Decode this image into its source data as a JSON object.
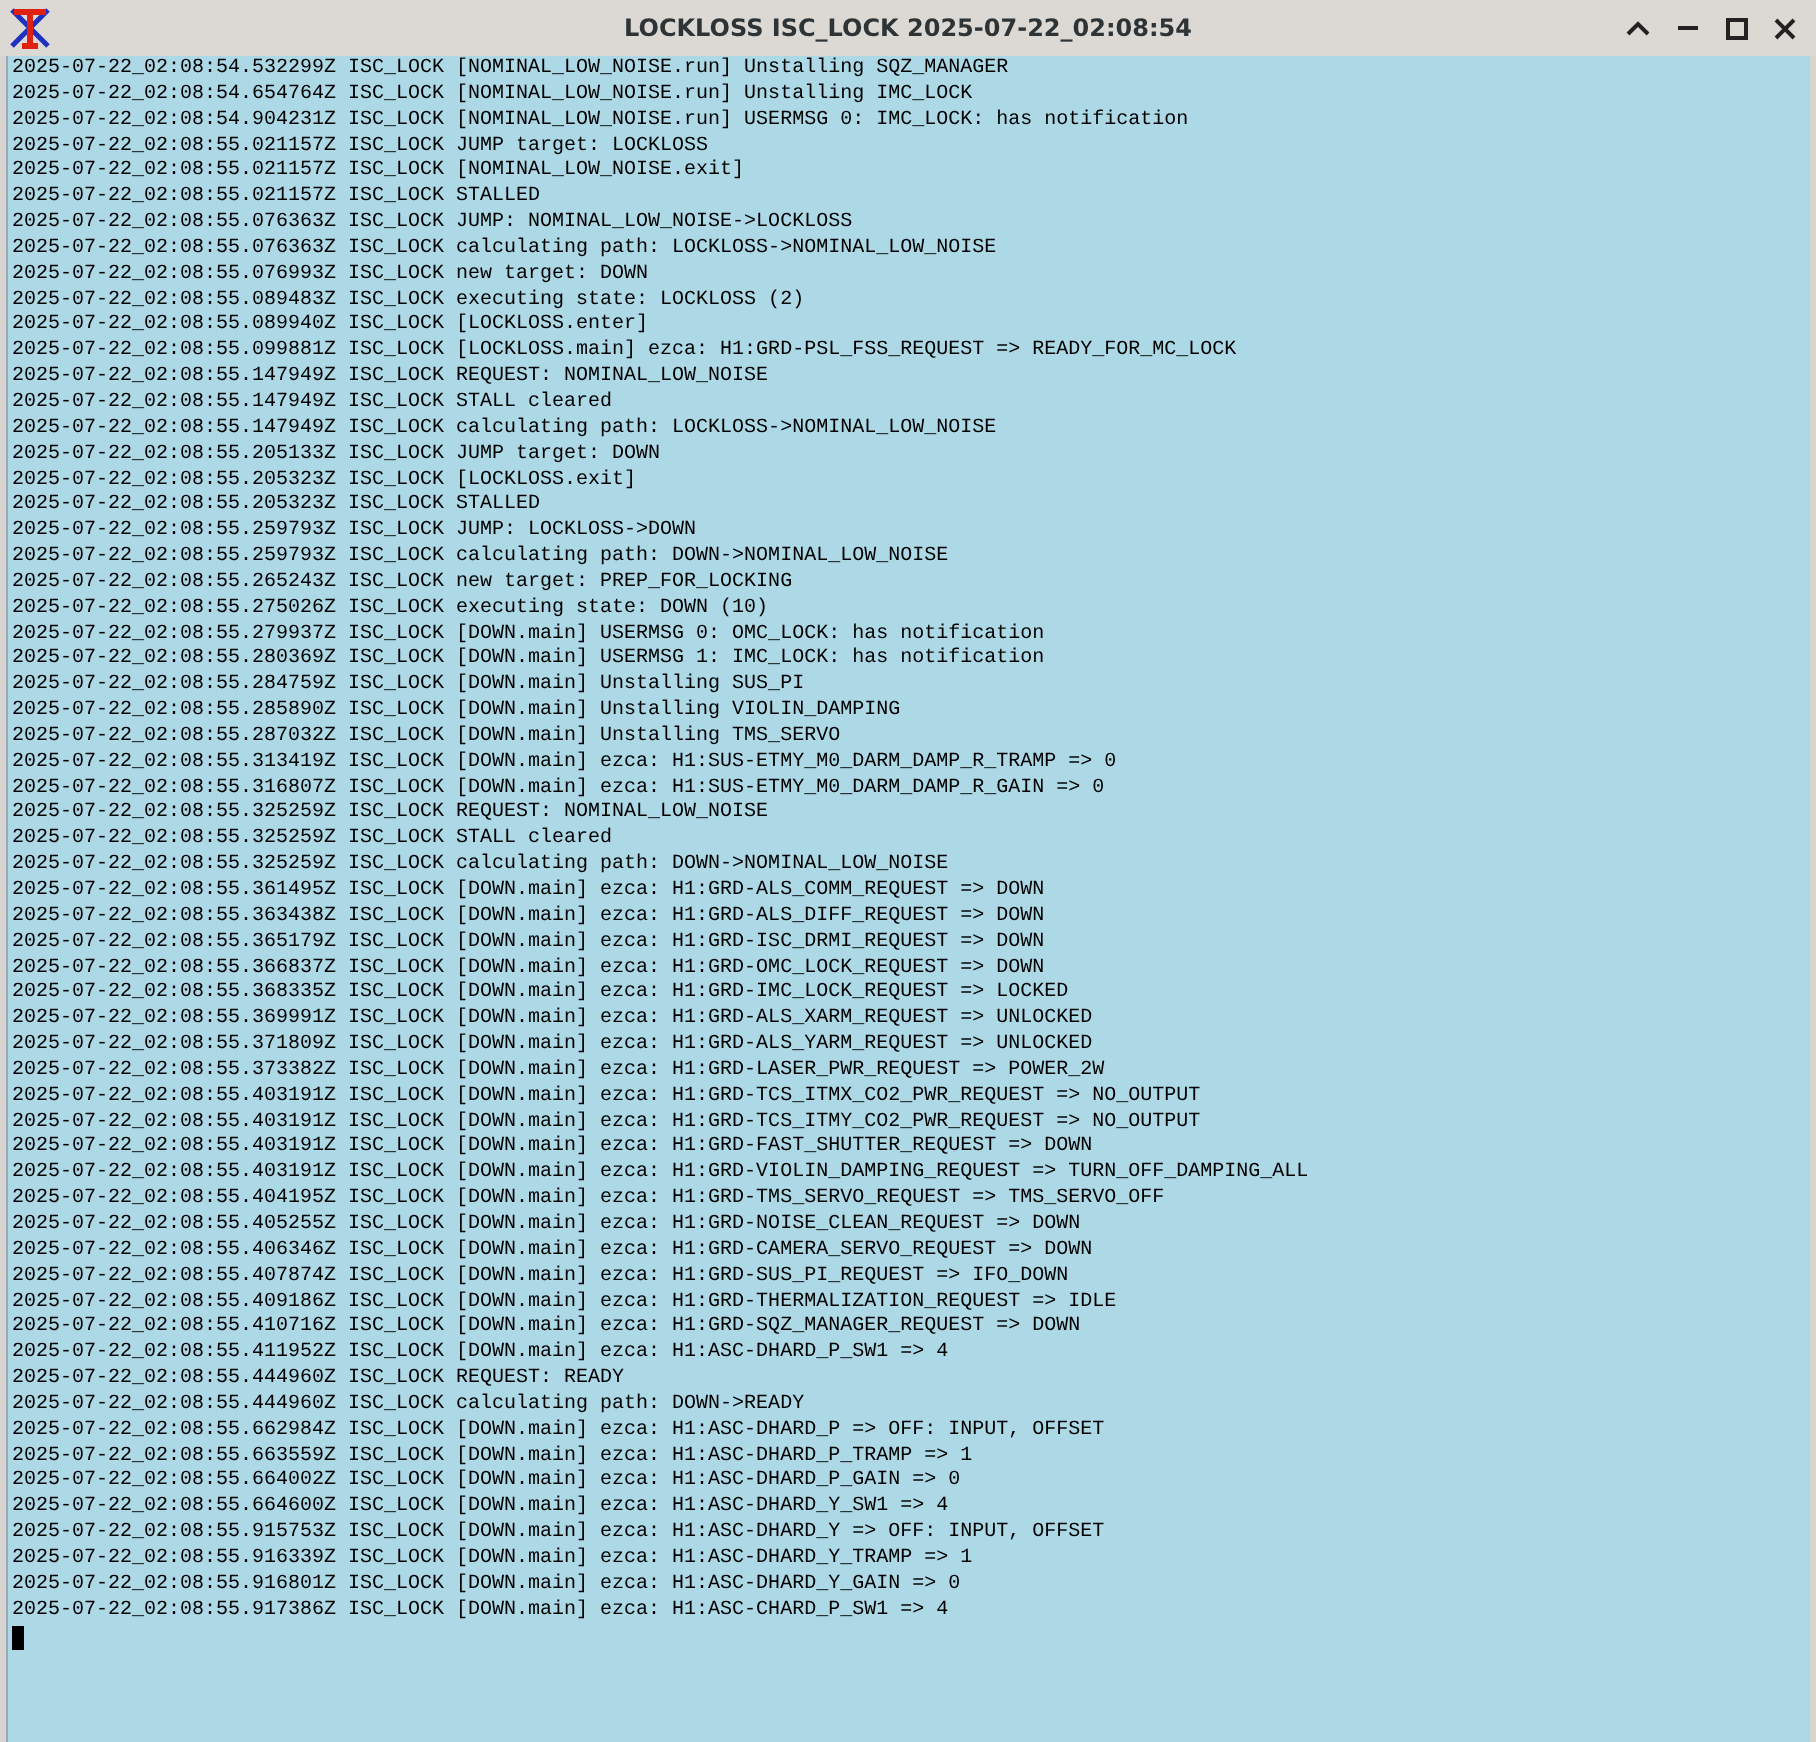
{
  "window": {
    "title": "LOCKLOSS ISC_LOCK 2025-07-22_02:08:54"
  },
  "log_lines": [
    "2025-07-22_02:08:54.532299Z ISC_LOCK [NOMINAL_LOW_NOISE.run] Unstalling SQZ_MANAGER",
    "2025-07-22_02:08:54.654764Z ISC_LOCK [NOMINAL_LOW_NOISE.run] Unstalling IMC_LOCK",
    "2025-07-22_02:08:54.904231Z ISC_LOCK [NOMINAL_LOW_NOISE.run] USERMSG 0: IMC_LOCK: has notification",
    "2025-07-22_02:08:55.021157Z ISC_LOCK JUMP target: LOCKLOSS",
    "2025-07-22_02:08:55.021157Z ISC_LOCK [NOMINAL_LOW_NOISE.exit]",
    "2025-07-22_02:08:55.021157Z ISC_LOCK STALLED",
    "2025-07-22_02:08:55.076363Z ISC_LOCK JUMP: NOMINAL_LOW_NOISE->LOCKLOSS",
    "2025-07-22_02:08:55.076363Z ISC_LOCK calculating path: LOCKLOSS->NOMINAL_LOW_NOISE",
    "2025-07-22_02:08:55.076993Z ISC_LOCK new target: DOWN",
    "2025-07-22_02:08:55.089483Z ISC_LOCK executing state: LOCKLOSS (2)",
    "2025-07-22_02:08:55.089940Z ISC_LOCK [LOCKLOSS.enter]",
    "2025-07-22_02:08:55.099881Z ISC_LOCK [LOCKLOSS.main] ezca: H1:GRD-PSL_FSS_REQUEST => READY_FOR_MC_LOCK",
    "2025-07-22_02:08:55.147949Z ISC_LOCK REQUEST: NOMINAL_LOW_NOISE",
    "2025-07-22_02:08:55.147949Z ISC_LOCK STALL cleared",
    "2025-07-22_02:08:55.147949Z ISC_LOCK calculating path: LOCKLOSS->NOMINAL_LOW_NOISE",
    "2025-07-22_02:08:55.205133Z ISC_LOCK JUMP target: DOWN",
    "2025-07-22_02:08:55.205323Z ISC_LOCK [LOCKLOSS.exit]",
    "2025-07-22_02:08:55.205323Z ISC_LOCK STALLED",
    "2025-07-22_02:08:55.259793Z ISC_LOCK JUMP: LOCKLOSS->DOWN",
    "2025-07-22_02:08:55.259793Z ISC_LOCK calculating path: DOWN->NOMINAL_LOW_NOISE",
    "2025-07-22_02:08:55.265243Z ISC_LOCK new target: PREP_FOR_LOCKING",
    "2025-07-22_02:08:55.275026Z ISC_LOCK executing state: DOWN (10)",
    "2025-07-22_02:08:55.279937Z ISC_LOCK [DOWN.main] USERMSG 0: OMC_LOCK: has notification",
    "2025-07-22_02:08:55.280369Z ISC_LOCK [DOWN.main] USERMSG 1: IMC_LOCK: has notification",
    "2025-07-22_02:08:55.284759Z ISC_LOCK [DOWN.main] Unstalling SUS_PI",
    "2025-07-22_02:08:55.285890Z ISC_LOCK [DOWN.main] Unstalling VIOLIN_DAMPING",
    "2025-07-22_02:08:55.287032Z ISC_LOCK [DOWN.main] Unstalling TMS_SERVO",
    "2025-07-22_02:08:55.313419Z ISC_LOCK [DOWN.main] ezca: H1:SUS-ETMY_M0_DARM_DAMP_R_TRAMP => 0",
    "2025-07-22_02:08:55.316807Z ISC_LOCK [DOWN.main] ezca: H1:SUS-ETMY_M0_DARM_DAMP_R_GAIN => 0",
    "2025-07-22_02:08:55.325259Z ISC_LOCK REQUEST: NOMINAL_LOW_NOISE",
    "2025-07-22_02:08:55.325259Z ISC_LOCK STALL cleared",
    "2025-07-22_02:08:55.325259Z ISC_LOCK calculating path: DOWN->NOMINAL_LOW_NOISE",
    "2025-07-22_02:08:55.361495Z ISC_LOCK [DOWN.main] ezca: H1:GRD-ALS_COMM_REQUEST => DOWN",
    "2025-07-22_02:08:55.363438Z ISC_LOCK [DOWN.main] ezca: H1:GRD-ALS_DIFF_REQUEST => DOWN",
    "2025-07-22_02:08:55.365179Z ISC_LOCK [DOWN.main] ezca: H1:GRD-ISC_DRMI_REQUEST => DOWN",
    "2025-07-22_02:08:55.366837Z ISC_LOCK [DOWN.main] ezca: H1:GRD-OMC_LOCK_REQUEST => DOWN",
    "2025-07-22_02:08:55.368335Z ISC_LOCK [DOWN.main] ezca: H1:GRD-IMC_LOCK_REQUEST => LOCKED",
    "2025-07-22_02:08:55.369991Z ISC_LOCK [DOWN.main] ezca: H1:GRD-ALS_XARM_REQUEST => UNLOCKED",
    "2025-07-22_02:08:55.371809Z ISC_LOCK [DOWN.main] ezca: H1:GRD-ALS_YARM_REQUEST => UNLOCKED",
    "2025-07-22_02:08:55.373382Z ISC_LOCK [DOWN.main] ezca: H1:GRD-LASER_PWR_REQUEST => POWER_2W",
    "2025-07-22_02:08:55.403191Z ISC_LOCK [DOWN.main] ezca: H1:GRD-TCS_ITMX_CO2_PWR_REQUEST => NO_OUTPUT",
    "2025-07-22_02:08:55.403191Z ISC_LOCK [DOWN.main] ezca: H1:GRD-TCS_ITMY_CO2_PWR_REQUEST => NO_OUTPUT",
    "2025-07-22_02:08:55.403191Z ISC_LOCK [DOWN.main] ezca: H1:GRD-FAST_SHUTTER_REQUEST => DOWN",
    "2025-07-22_02:08:55.403191Z ISC_LOCK [DOWN.main] ezca: H1:GRD-VIOLIN_DAMPING_REQUEST => TURN_OFF_DAMPING_ALL",
    "2025-07-22_02:08:55.404195Z ISC_LOCK [DOWN.main] ezca: H1:GRD-TMS_SERVO_REQUEST => TMS_SERVO_OFF",
    "2025-07-22_02:08:55.405255Z ISC_LOCK [DOWN.main] ezca: H1:GRD-NOISE_CLEAN_REQUEST => DOWN",
    "2025-07-22_02:08:55.406346Z ISC_LOCK [DOWN.main] ezca: H1:GRD-CAMERA_SERVO_REQUEST => DOWN",
    "2025-07-22_02:08:55.407874Z ISC_LOCK [DOWN.main] ezca: H1:GRD-SUS_PI_REQUEST => IFO_DOWN",
    "2025-07-22_02:08:55.409186Z ISC_LOCK [DOWN.main] ezca: H1:GRD-THERMALIZATION_REQUEST => IDLE",
    "2025-07-22_02:08:55.410716Z ISC_LOCK [DOWN.main] ezca: H1:GRD-SQZ_MANAGER_REQUEST => DOWN",
    "2025-07-22_02:08:55.411952Z ISC_LOCK [DOWN.main] ezca: H1:ASC-DHARD_P_SW1 => 4",
    "2025-07-22_02:08:55.444960Z ISC_LOCK REQUEST: READY",
    "2025-07-22_02:08:55.444960Z ISC_LOCK calculating path: DOWN->READY",
    "2025-07-22_02:08:55.662984Z ISC_LOCK [DOWN.main] ezca: H1:ASC-DHARD_P => OFF: INPUT, OFFSET",
    "2025-07-22_02:08:55.663559Z ISC_LOCK [DOWN.main] ezca: H1:ASC-DHARD_P_TRAMP => 1",
    "2025-07-22_02:08:55.664002Z ISC_LOCK [DOWN.main] ezca: H1:ASC-DHARD_P_GAIN => 0",
    "2025-07-22_02:08:55.664600Z ISC_LOCK [DOWN.main] ezca: H1:ASC-DHARD_Y_SW1 => 4",
    "2025-07-22_02:08:55.915753Z ISC_LOCK [DOWN.main] ezca: H1:ASC-DHARD_Y => OFF: INPUT, OFFSET",
    "2025-07-22_02:08:55.916339Z ISC_LOCK [DOWN.main] ezca: H1:ASC-DHARD_Y_TRAMP => 1",
    "2025-07-22_02:08:55.916801Z ISC_LOCK [DOWN.main] ezca: H1:ASC-DHARD_Y_GAIN => 0",
    "2025-07-22_02:08:55.917386Z ISC_LOCK [DOWN.main] ezca: H1:ASC-CHARD_P_SW1 => 4"
  ]
}
